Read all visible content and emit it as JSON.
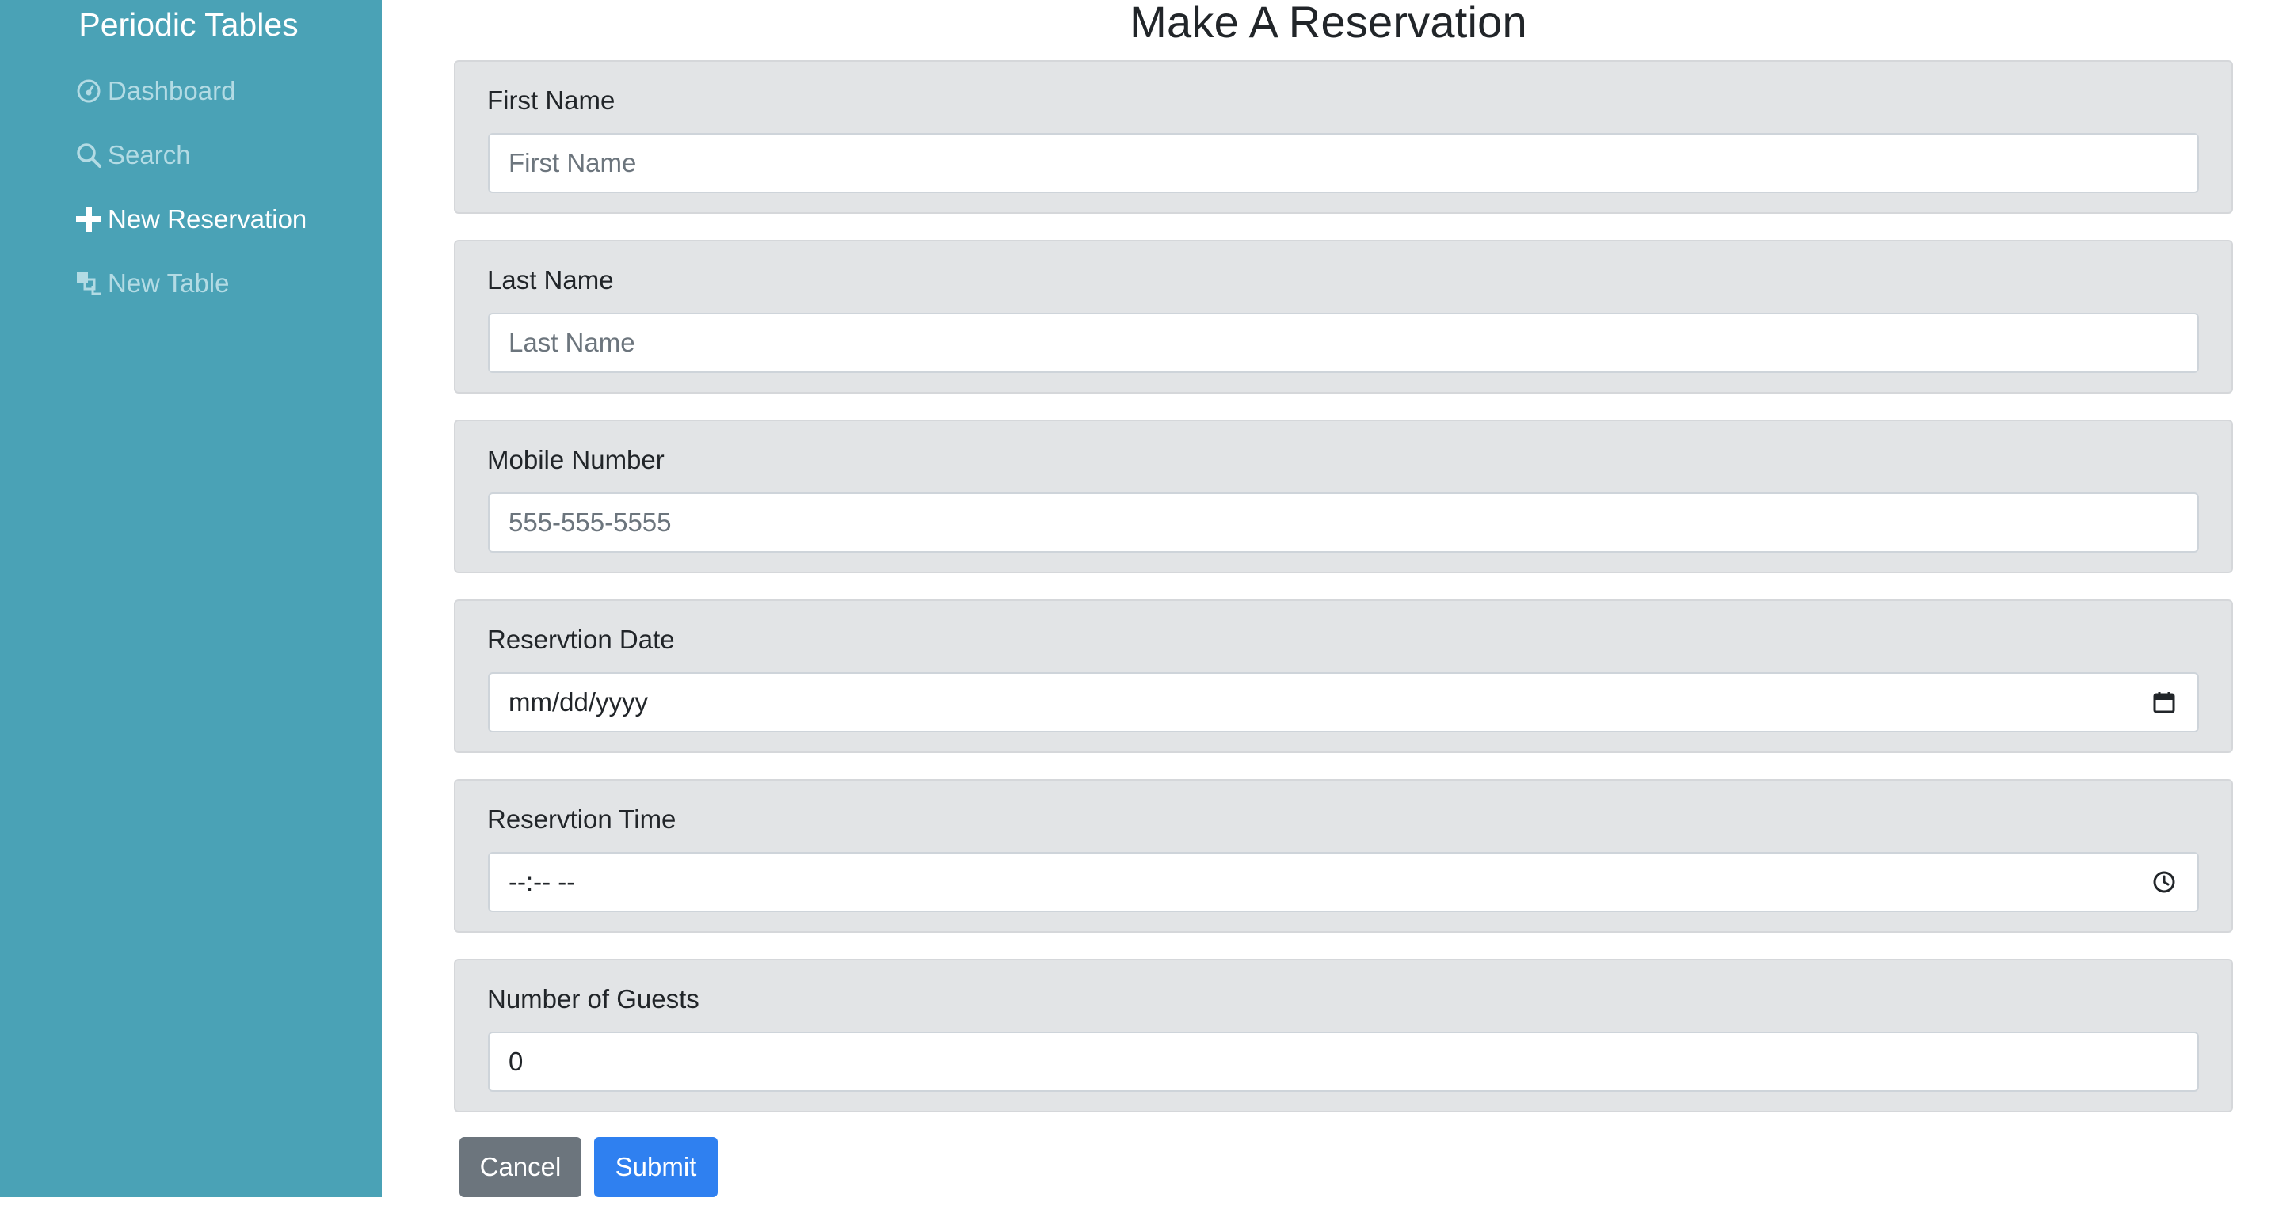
{
  "theme": {
    "sidebar_bg": "#4aa2b6",
    "card_bg": "#e2e4e6",
    "nav_active": "#ffffff",
    "nav_inactive": "#b3dbe4",
    "placeholder": "#6c757d",
    "cancel_bg": "#6c757d",
    "submit_bg": "#2f80f0"
  },
  "sidebar": {
    "brand": "Periodic Tables",
    "items": [
      {
        "label": "Dashboard",
        "icon": "dashboard-icon",
        "active": false
      },
      {
        "label": "Search",
        "icon": "search-icon",
        "active": false
      },
      {
        "label": "New Reservation",
        "icon": "plus-icon",
        "active": true
      },
      {
        "label": "New Table",
        "icon": "layers-icon",
        "active": false
      }
    ]
  },
  "page": {
    "title": "Make A Reservation"
  },
  "form": {
    "fields": [
      {
        "label": "First Name",
        "placeholder": "First Name",
        "value": ""
      },
      {
        "label": "Last Name",
        "placeholder": "Last Name",
        "value": ""
      },
      {
        "label": "Mobile Number",
        "placeholder": "555-555-5555",
        "value": ""
      },
      {
        "label": "Reservtion Date",
        "placeholder": "mm/dd/yyyy",
        "value": "",
        "icon": "calendar-icon"
      },
      {
        "label": "Reservtion Time",
        "placeholder": "--:-- --",
        "value": "",
        "icon": "clock-icon"
      },
      {
        "label": "Number of Guests",
        "placeholder": "",
        "value": "0"
      }
    ],
    "cancel_label": "Cancel",
    "submit_label": "Submit"
  }
}
